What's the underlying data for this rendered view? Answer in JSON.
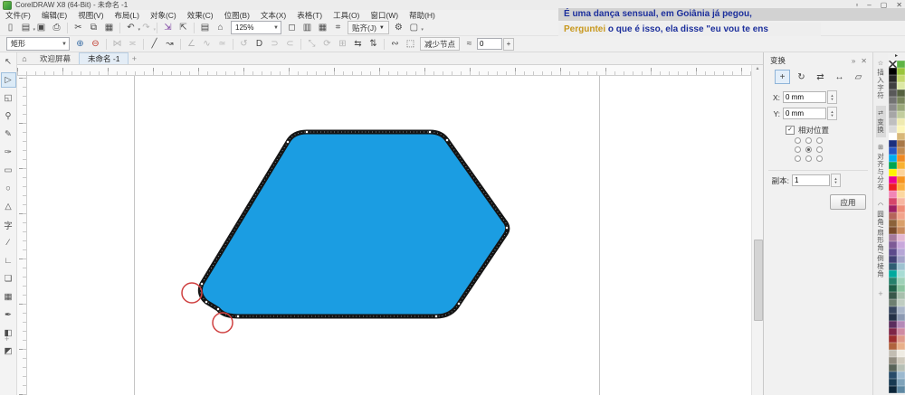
{
  "window": {
    "title": "CorelDRAW X8 (64-Bit) - 未命名 -1"
  },
  "window_controls": {
    "badge": "▫",
    "minimize": "–",
    "restore": "▢",
    "close": "✕"
  },
  "subtitles": {
    "line1": "É uma dança sensual, em Goiânia já pegou,",
    "line2_lead": "Perguntei",
    "line2_rest": " o que é isso, ela disse \"eu vou te ens",
    "lead_color": "#c8981d",
    "body_color": "#1c2f9c"
  },
  "menubar": {
    "items": [
      "文件(F)",
      "编辑(E)",
      "视图(V)",
      "布局(L)",
      "对象(C)",
      "效果(C)",
      "位图(B)",
      "文本(X)",
      "表格(T)",
      "工具(O)",
      "窗口(W)",
      "帮助(H)"
    ]
  },
  "toolbar": {
    "left_icons": [
      {
        "name": "new-document-icon",
        "glyph": "▯"
      },
      {
        "name": "open-icon",
        "glyph": "▤",
        "dd": true
      },
      {
        "name": "save-icon",
        "glyph": "▣"
      },
      {
        "name": "print-icon",
        "glyph": "⎙"
      },
      {
        "sep": true
      },
      {
        "name": "cut-icon",
        "glyph": "✂"
      },
      {
        "name": "copy-icon",
        "glyph": "⧉"
      },
      {
        "name": "paste-icon",
        "glyph": "▦"
      },
      {
        "sep": true
      },
      {
        "name": "undo-icon",
        "glyph": "↶",
        "dd": true
      },
      {
        "name": "redo-icon",
        "glyph": "↷",
        "dd": true,
        "off": true
      },
      {
        "sep": true
      },
      {
        "name": "import-icon",
        "glyph": "⇲",
        "color": "#7b3fa0"
      },
      {
        "name": "export-icon",
        "glyph": "⇱"
      },
      {
        "sep": true
      },
      {
        "name": "app-launcher-icon",
        "glyph": "▤"
      },
      {
        "name": "welcome-screen-icon",
        "glyph": "⌂"
      }
    ],
    "zoom_value": "125%",
    "right_icons": [
      {
        "name": "fullscreen-preview-icon",
        "glyph": "◻"
      },
      {
        "name": "show-rulers-icon",
        "glyph": "▥"
      },
      {
        "name": "show-grid-icon",
        "glyph": "▦"
      },
      {
        "name": "alignment-guides-icon",
        "glyph": "⌗"
      }
    ],
    "snap_label": "贴齐(J)",
    "gear_glyph": "⚙",
    "window_layout_glyph": "▢"
  },
  "propbar": {
    "mode_value": "矩形",
    "icons": [
      {
        "name": "add-node-icon",
        "glyph": "⊕",
        "color": "#3a6ea5"
      },
      {
        "name": "delete-node-icon",
        "glyph": "⊖",
        "color": "#c0392b"
      },
      {
        "sep": true
      },
      {
        "name": "join-nodes-icon",
        "glyph": "⋈",
        "off": true
      },
      {
        "name": "break-node-icon",
        "glyph": "≍",
        "off": true
      },
      {
        "sep": true
      },
      {
        "name": "to-line-icon",
        "glyph": "╱"
      },
      {
        "name": "to-curve-icon",
        "glyph": "↝"
      },
      {
        "sep": true
      },
      {
        "name": "cusp-node-icon",
        "glyph": "∠",
        "off": true
      },
      {
        "name": "smooth-node-icon",
        "glyph": "∿",
        "off": true
      },
      {
        "name": "symmetric-node-icon",
        "glyph": "≃",
        "off": true
      },
      {
        "sep": true
      },
      {
        "name": "reverse-direction-icon",
        "glyph": "↺",
        "off": true
      },
      {
        "name": "close-curve-icon",
        "glyph": "D"
      },
      {
        "name": "extract-subpath-icon",
        "glyph": "⊃",
        "off": true
      },
      {
        "name": "extend-curve-close-icon",
        "glyph": "⊂",
        "off": true
      },
      {
        "sep": true
      },
      {
        "name": "stretch-nodes-icon",
        "glyph": "⤡",
        "off": true
      },
      {
        "name": "rotate-nodes-icon",
        "glyph": "⟳",
        "off": true
      },
      {
        "name": "align-nodes-icon",
        "glyph": "⊞",
        "off": true
      },
      {
        "name": "reflect-h-icon",
        "glyph": "⇆"
      },
      {
        "name": "reflect-v-icon",
        "glyph": "⇅"
      },
      {
        "sep": true
      },
      {
        "name": "elastic-mode-icon",
        "glyph": "∾"
      },
      {
        "name": "select-all-nodes-icon",
        "glyph": "⬚"
      }
    ],
    "reduce_label": "减少节点",
    "smooth_icon": "≈",
    "smooth_value": "0",
    "smooth_plus": "+"
  },
  "tabs": {
    "home_icon": "⌂",
    "welcome": "欢迎屏幕",
    "document": "未命名 -1",
    "newtab": "+"
  },
  "toolbox": {
    "tools": [
      {
        "name": "pick-tool",
        "glyph": "↖"
      },
      {
        "name": "shape-tool",
        "glyph": "▷",
        "active": true
      },
      {
        "name": "crop-tool",
        "glyph": "◱"
      },
      {
        "name": "zoom-tool",
        "glyph": "⚲"
      },
      {
        "name": "freehand-tool",
        "glyph": "✎"
      },
      {
        "name": "artistic-media-tool",
        "glyph": "✑"
      },
      {
        "name": "rectangle-tool",
        "glyph": "▭"
      },
      {
        "name": "ellipse-tool",
        "glyph": "○"
      },
      {
        "name": "polygon-tool",
        "glyph": "△"
      },
      {
        "name": "text-tool",
        "glyph": "字"
      },
      {
        "name": "dimension-tool",
        "glyph": "∕"
      },
      {
        "name": "connector-tool",
        "glyph": "∟"
      },
      {
        "name": "drop-shadow-tool",
        "glyph": "❏"
      },
      {
        "name": "transparency-tool",
        "glyph": "▦"
      },
      {
        "name": "color-eyedropper-tool",
        "glyph": "✒"
      },
      {
        "name": "interactive-fill-tool",
        "glyph": "◧"
      },
      {
        "name": "smart-fill-tool",
        "glyph": "◩"
      }
    ],
    "more_glyph": "+"
  },
  "docker": {
    "title": "变换",
    "collapse_icon": "»",
    "close_icon": "✕",
    "transform_icons": [
      {
        "name": "position-transform-icon",
        "glyph": "+",
        "active": true
      },
      {
        "name": "rotate-transform-icon",
        "glyph": "↻"
      },
      {
        "name": "scale-mirror-transform-icon",
        "glyph": "⇄"
      },
      {
        "name": "size-transform-icon",
        "glyph": "↔"
      },
      {
        "name": "skew-transform-icon",
        "glyph": "▱"
      }
    ],
    "x_label": "X:",
    "x_value": "0 mm",
    "y_label": "Y:",
    "y_value": "0 mm",
    "relative_check": "✓",
    "relative_label": "相对位置",
    "anchors": [
      {},
      {},
      {},
      {},
      {
        "active": true
      },
      {},
      {},
      {},
      {}
    ],
    "copies_label": "副本:",
    "copies_value": "1",
    "apply_label": "应用"
  },
  "docker_tabs": [
    {
      "name": "docker-tab-insert-character",
      "icon": "☆",
      "label": "插入字符"
    },
    {
      "name": "docker-tab-transform",
      "icon": "⇄",
      "label": "变换",
      "active": true
    },
    {
      "name": "docker-tab-align-distribute",
      "icon": "⊞",
      "label": "对齐与分布"
    },
    {
      "name": "docker-tab-corners",
      "icon": "◠",
      "label": "圆角/扇形角/倒棱角"
    }
  ],
  "add_docker_glyph": "+",
  "palette": {
    "flyout_icon": "▸",
    "colors": [
      "none",
      "#5fb445",
      "#000000",
      "#9bc53d",
      "#262626",
      "#c5d86d",
      "#404040",
      "#dce8a6",
      "#595959",
      "#55613f",
      "#737373",
      "#79855c",
      "#8c8c8c",
      "#9aa87a",
      "#a6a6a6",
      "#c2cd9e",
      "#bfbfbf",
      "#efeab0",
      "#d9d9d9",
      "#fdf6b8",
      "#ffffff",
      "#d9b878",
      "#1b2f7e",
      "#a87848",
      "#2456c4",
      "#c08b52",
      "#00adef",
      "#f08a24",
      "#00a550",
      "#f9b233",
      "#fff200",
      "#fcd39a",
      "#ec008c",
      "#f7941e",
      "#ed1c24",
      "#fbb040",
      "#f286b6",
      "#fcd7a1",
      "#d6456b",
      "#f7b6a1",
      "#9e1f63",
      "#ef8d77",
      "#b5645a",
      "#f2a48c",
      "#8c6239",
      "#d9a06b",
      "#7a4a2b",
      "#c98a5e",
      "#a5799c",
      "#e3b8d3",
      "#7d5a96",
      "#c9a8dc",
      "#5c4a8c",
      "#b6a6d6",
      "#3f3f74",
      "#a3a3c9",
      "#2e5e73",
      "#9fc3d1",
      "#00a99d",
      "#a8dcd4",
      "#26806b",
      "#9ed1b8",
      "#1e5e46",
      "#8cc4a0",
      "#39584a",
      "#a9c0ae",
      "#6e7f71",
      "#c0cdc2",
      "#36455e",
      "#aab6c9",
      "#233046",
      "#8d9ab3",
      "#5b2d5e",
      "#b58ab8",
      "#7e2547",
      "#cf8ba3",
      "#9c2d2d",
      "#df9a8a",
      "#b0633c",
      "#e8b08a",
      "#c2bdb2",
      "#efece3",
      "#8f8a7e",
      "#cfcabd",
      "#586358",
      "#b7c0b6",
      "#274a68",
      "#9cb9cf",
      "#173a52",
      "#7fa3ba",
      "#0b2538",
      "#5f89a3"
    ]
  },
  "canvas": {
    "page_line_color": "#c4c4c4"
  },
  "shape": {
    "fill": "#1b9de2",
    "stroke": "#141414",
    "annotation_color": "#cf4040"
  },
  "scroll": {
    "up_glyph": "▴"
  }
}
